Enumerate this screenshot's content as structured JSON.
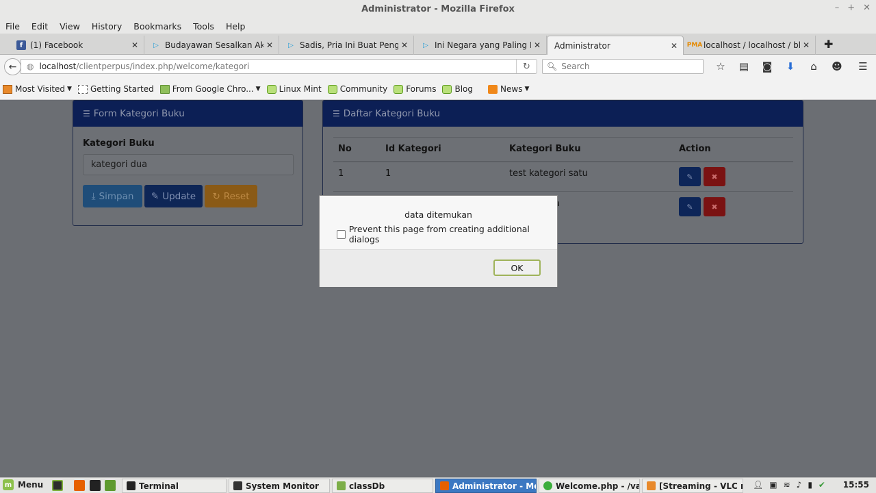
{
  "window": {
    "title": "Administrator - Mozilla Firefox"
  },
  "menubar": [
    "File",
    "Edit",
    "View",
    "History",
    "Bookmarks",
    "Tools",
    "Help"
  ],
  "tabs": [
    {
      "label": "(1) Facebook"
    },
    {
      "label": "Budayawan Sesalkan Aks..."
    },
    {
      "label": "Sadis, Pria Ini Buat Pengu..."
    },
    {
      "label": "Ini Negara yang Paling Di..."
    },
    {
      "label": "Administrator"
    },
    {
      "label": "localhost / localhost / blo..."
    }
  ],
  "address": {
    "host": "localhost",
    "path": "/clientperpus/index.php/welcome/kategori"
  },
  "search": {
    "placeholder": "Search"
  },
  "bookmarks": [
    {
      "label": "Most Visited"
    },
    {
      "label": "Getting Started"
    },
    {
      "label": "From Google Chro..."
    },
    {
      "label": "Linux Mint"
    },
    {
      "label": "Community"
    },
    {
      "label": "Forums"
    },
    {
      "label": "Blog"
    },
    {
      "label": "News"
    }
  ],
  "form": {
    "title": "Form Kategori Buku",
    "field_label": "Kategori Buku",
    "field_value": "kategori dua",
    "buttons": {
      "save": "Simpan",
      "update": "Update",
      "reset": "Reset"
    }
  },
  "table": {
    "title": "Daftar Kategori Buku",
    "headers": [
      "No",
      "Id Kategori",
      "Kategori Buku",
      "Action"
    ],
    "rows": [
      {
        "no": "1",
        "id": "1",
        "name": "test kategori satu"
      },
      {
        "name_tail": "a"
      }
    ]
  },
  "dialog": {
    "message": "data ditemukan",
    "checkbox_label": "Prevent this page from creating additional dialogs",
    "ok_label": "OK"
  },
  "taskbar": {
    "menu_label": "Menu",
    "tasks": [
      {
        "label": "Terminal"
      },
      {
        "label": "System Monitor"
      },
      {
        "label": "classDb"
      },
      {
        "label": "Administrator - Mo..."
      },
      {
        "label": "Welcome.php - /va..."
      },
      {
        "label": "[Streaming - VLC m..."
      }
    ],
    "clock": "15:55"
  },
  "colors": {
    "panel_header": "#0c1f55",
    "btn_save": "#1f4d79",
    "btn_update": "#0e2656",
    "btn_reset": "#8a5a16",
    "btn_delete": "#7a1212",
    "taskbar_active": "#3c78c2"
  }
}
